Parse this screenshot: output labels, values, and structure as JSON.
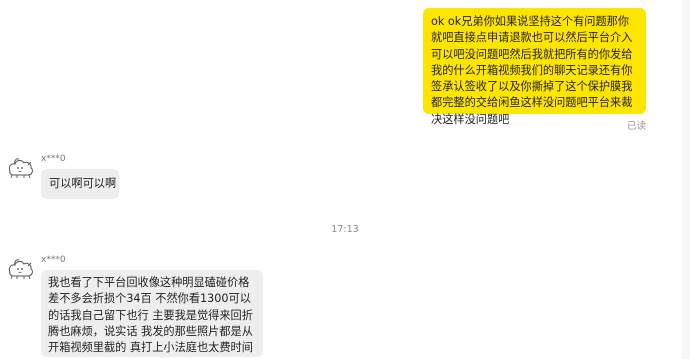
{
  "messages": {
    "outgoing": {
      "text": "ok ok兄弟你如果说坚持这个有问题那你就吧直接点申请退款也可以然后平台介入可以吧没问题吧然后我就把所有的你发给我的什么开箱视频我们的聊天记录还有你签承认签收了以及你撕掉了这个保护膜我都完整的交给闲鱼这样没问题吧平台来裁决这样没问题吧",
      "status": "已读"
    },
    "incoming_1": {
      "sender": "x***0",
      "text": "可以啊可以啊"
    },
    "time_divider": "17:13",
    "incoming_2": {
      "sender": "x***0",
      "text": "我也看了下平台回收像这种明显磕碰价格差不多会折损个34百 不然你看1300可以的话我自己留下也行 主要我是觉得来回折腾也麻烦，说实话 我发的那些照片都是从开箱视频里截的 真打上小法庭也太费时间"
    }
  },
  "icons": {
    "avatar": "sheep-doodle-avatar-icon"
  },
  "colors": {
    "outgoing_bubble": "#fee500",
    "incoming_bubble": "#eeeeee",
    "muted_text": "#9a9a9a"
  }
}
